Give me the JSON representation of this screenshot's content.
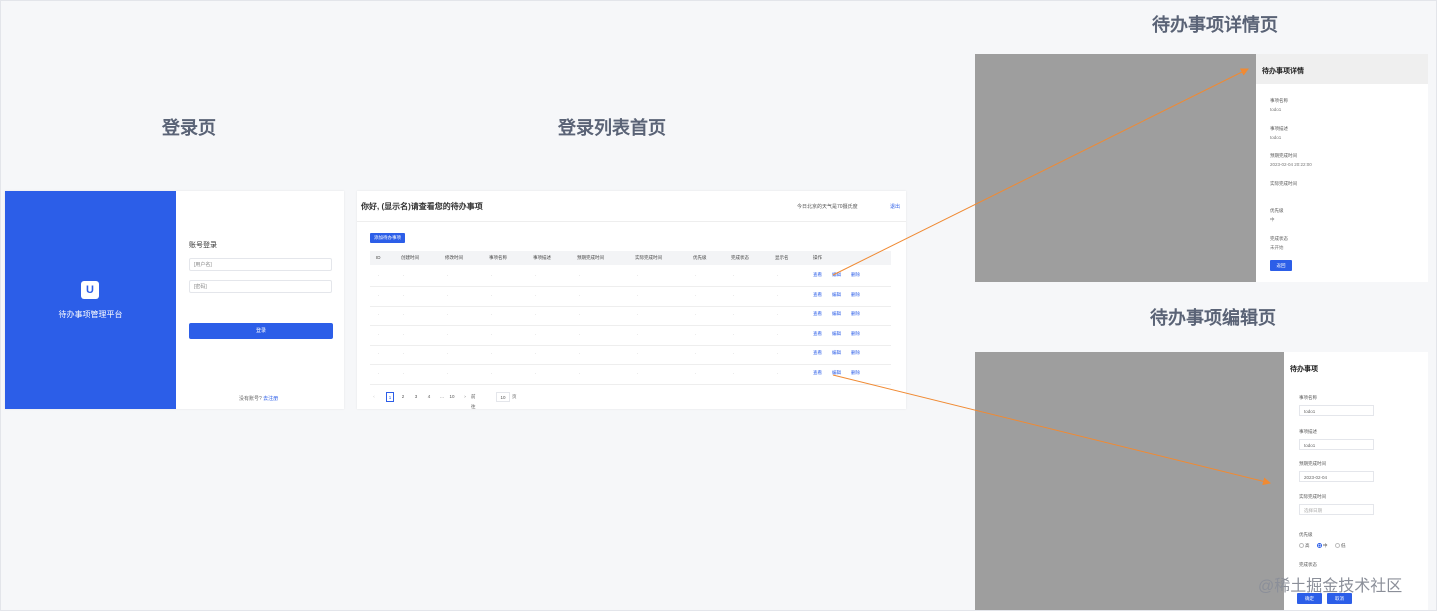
{
  "sections": {
    "login": "登录页",
    "list": "登录列表首页",
    "detail": "待办事项详情页",
    "edit": "待办事项编辑页"
  },
  "login": {
    "brand": "待办事项管理平台",
    "form_title": "账号登录",
    "username_placeholder": "[用户名]",
    "password_placeholder": "[密码]",
    "login_button": "登录",
    "register_prompt": "没有账号?",
    "register_link": "去注册",
    "logo_text": "U"
  },
  "list": {
    "greeting": "你好, (显示名)请查看您的待办事项",
    "weather": "今日北京的天气是70摄氏度",
    "logout": "退出",
    "add_button": "添加待办事项",
    "columns": [
      "ID",
      "创建时间",
      "修改时间",
      "事项名称",
      "事项描述",
      "预期完成时间",
      "实际完成时间",
      "优先级",
      "完成状态",
      "显示名",
      "操作"
    ],
    "actions": [
      "查看",
      "编辑",
      "删除"
    ],
    "placeholder_cell": "·",
    "pager": {
      "prev": "‹",
      "pages": [
        "1",
        "2",
        "3",
        "4",
        "...",
        "10"
      ],
      "next": "›",
      "jump_label": "前往",
      "jump_value": "10",
      "unit": "页"
    }
  },
  "detail": {
    "title": "待办事项详情",
    "fields": [
      {
        "label": "事项名称",
        "value": "todo1"
      },
      {
        "label": "事项描述",
        "value": "todo1"
      },
      {
        "label": "预期完成时间",
        "value": "2023-02-04 20:22:00"
      },
      {
        "label": "实际完成时间",
        "value": ""
      },
      {
        "label": "优先级",
        "value": "中"
      },
      {
        "label": "完成状态",
        "value": "未开始"
      }
    ],
    "back_button": "返回"
  },
  "edit": {
    "title": "待办事项",
    "fields": [
      {
        "label": "事项名称",
        "value": "todo1"
      },
      {
        "label": "事项描述",
        "value": "todo1"
      },
      {
        "label": "预期完成时间",
        "value": "2023-02-04"
      },
      {
        "label": "实际完成时间",
        "value": "选择日期"
      }
    ],
    "priority_label": "优先级",
    "priority_options": [
      "高",
      "中",
      "低"
    ],
    "priority_selected": "中",
    "status_label": "完成状态",
    "confirm_button": "确定",
    "cancel_button": "取消"
  },
  "watermark": "@稀土掘金技术社区",
  "colors": {
    "primary": "#2c5ee8",
    "arrow": "#f08a33",
    "shade": "#9e9e9e"
  }
}
